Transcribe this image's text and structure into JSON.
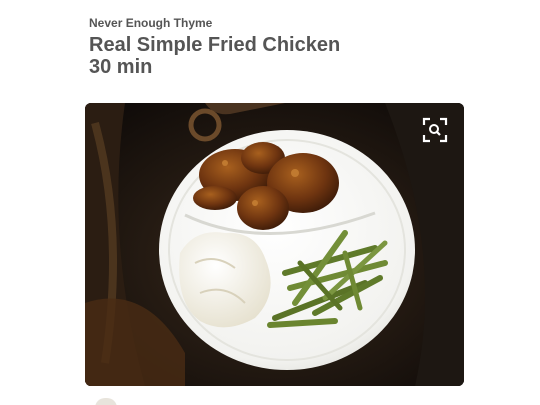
{
  "pin": {
    "source": "Never Enough Thyme",
    "title": "Real Simple Fried Chicken",
    "time": "30 min"
  },
  "photo": {
    "zoom_icon": "magnify-expand-icon"
  }
}
